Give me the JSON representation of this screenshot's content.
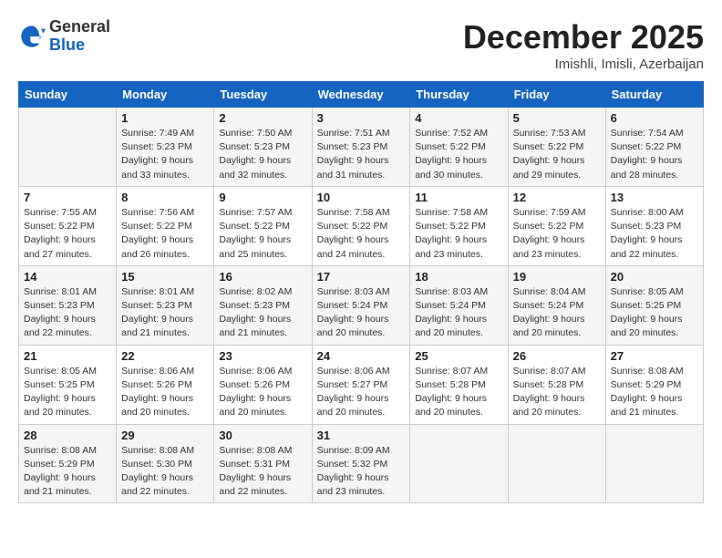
{
  "logo": {
    "general": "General",
    "blue": "Blue"
  },
  "title": "December 2025",
  "subtitle": "Imishli, Imisli, Azerbaijan",
  "weekdays": [
    "Sunday",
    "Monday",
    "Tuesday",
    "Wednesday",
    "Thursday",
    "Friday",
    "Saturday"
  ],
  "weeks": [
    [
      {
        "day": "",
        "info": ""
      },
      {
        "day": "1",
        "info": "Sunrise: 7:49 AM\nSunset: 5:23 PM\nDaylight: 9 hours\nand 33 minutes."
      },
      {
        "day": "2",
        "info": "Sunrise: 7:50 AM\nSunset: 5:23 PM\nDaylight: 9 hours\nand 32 minutes."
      },
      {
        "day": "3",
        "info": "Sunrise: 7:51 AM\nSunset: 5:23 PM\nDaylight: 9 hours\nand 31 minutes."
      },
      {
        "day": "4",
        "info": "Sunrise: 7:52 AM\nSunset: 5:22 PM\nDaylight: 9 hours\nand 30 minutes."
      },
      {
        "day": "5",
        "info": "Sunrise: 7:53 AM\nSunset: 5:22 PM\nDaylight: 9 hours\nand 29 minutes."
      },
      {
        "day": "6",
        "info": "Sunrise: 7:54 AM\nSunset: 5:22 PM\nDaylight: 9 hours\nand 28 minutes."
      }
    ],
    [
      {
        "day": "7",
        "info": "Sunrise: 7:55 AM\nSunset: 5:22 PM\nDaylight: 9 hours\nand 27 minutes."
      },
      {
        "day": "8",
        "info": "Sunrise: 7:56 AM\nSunset: 5:22 PM\nDaylight: 9 hours\nand 26 minutes."
      },
      {
        "day": "9",
        "info": "Sunrise: 7:57 AM\nSunset: 5:22 PM\nDaylight: 9 hours\nand 25 minutes."
      },
      {
        "day": "10",
        "info": "Sunrise: 7:58 AM\nSunset: 5:22 PM\nDaylight: 9 hours\nand 24 minutes."
      },
      {
        "day": "11",
        "info": "Sunrise: 7:58 AM\nSunset: 5:22 PM\nDaylight: 9 hours\nand 23 minutes."
      },
      {
        "day": "12",
        "info": "Sunrise: 7:59 AM\nSunset: 5:22 PM\nDaylight: 9 hours\nand 23 minutes."
      },
      {
        "day": "13",
        "info": "Sunrise: 8:00 AM\nSunset: 5:23 PM\nDaylight: 9 hours\nand 22 minutes."
      }
    ],
    [
      {
        "day": "14",
        "info": "Sunrise: 8:01 AM\nSunset: 5:23 PM\nDaylight: 9 hours\nand 22 minutes."
      },
      {
        "day": "15",
        "info": "Sunrise: 8:01 AM\nSunset: 5:23 PM\nDaylight: 9 hours\nand 21 minutes."
      },
      {
        "day": "16",
        "info": "Sunrise: 8:02 AM\nSunset: 5:23 PM\nDaylight: 9 hours\nand 21 minutes."
      },
      {
        "day": "17",
        "info": "Sunrise: 8:03 AM\nSunset: 5:24 PM\nDaylight: 9 hours\nand 20 minutes."
      },
      {
        "day": "18",
        "info": "Sunrise: 8:03 AM\nSunset: 5:24 PM\nDaylight: 9 hours\nand 20 minutes."
      },
      {
        "day": "19",
        "info": "Sunrise: 8:04 AM\nSunset: 5:24 PM\nDaylight: 9 hours\nand 20 minutes."
      },
      {
        "day": "20",
        "info": "Sunrise: 8:05 AM\nSunset: 5:25 PM\nDaylight: 9 hours\nand 20 minutes."
      }
    ],
    [
      {
        "day": "21",
        "info": "Sunrise: 8:05 AM\nSunset: 5:25 PM\nDaylight: 9 hours\nand 20 minutes."
      },
      {
        "day": "22",
        "info": "Sunrise: 8:06 AM\nSunset: 5:26 PM\nDaylight: 9 hours\nand 20 minutes."
      },
      {
        "day": "23",
        "info": "Sunrise: 8:06 AM\nSunset: 5:26 PM\nDaylight: 9 hours\nand 20 minutes."
      },
      {
        "day": "24",
        "info": "Sunrise: 8:06 AM\nSunset: 5:27 PM\nDaylight: 9 hours\nand 20 minutes."
      },
      {
        "day": "25",
        "info": "Sunrise: 8:07 AM\nSunset: 5:28 PM\nDaylight: 9 hours\nand 20 minutes."
      },
      {
        "day": "26",
        "info": "Sunrise: 8:07 AM\nSunset: 5:28 PM\nDaylight: 9 hours\nand 20 minutes."
      },
      {
        "day": "27",
        "info": "Sunrise: 8:08 AM\nSunset: 5:29 PM\nDaylight: 9 hours\nand 21 minutes."
      }
    ],
    [
      {
        "day": "28",
        "info": "Sunrise: 8:08 AM\nSunset: 5:29 PM\nDaylight: 9 hours\nand 21 minutes."
      },
      {
        "day": "29",
        "info": "Sunrise: 8:08 AM\nSunset: 5:30 PM\nDaylight: 9 hours\nand 22 minutes."
      },
      {
        "day": "30",
        "info": "Sunrise: 8:08 AM\nSunset: 5:31 PM\nDaylight: 9 hours\nand 22 minutes."
      },
      {
        "day": "31",
        "info": "Sunrise: 8:09 AM\nSunset: 5:32 PM\nDaylight: 9 hours\nand 23 minutes."
      },
      {
        "day": "",
        "info": ""
      },
      {
        "day": "",
        "info": ""
      },
      {
        "day": "",
        "info": ""
      }
    ]
  ]
}
